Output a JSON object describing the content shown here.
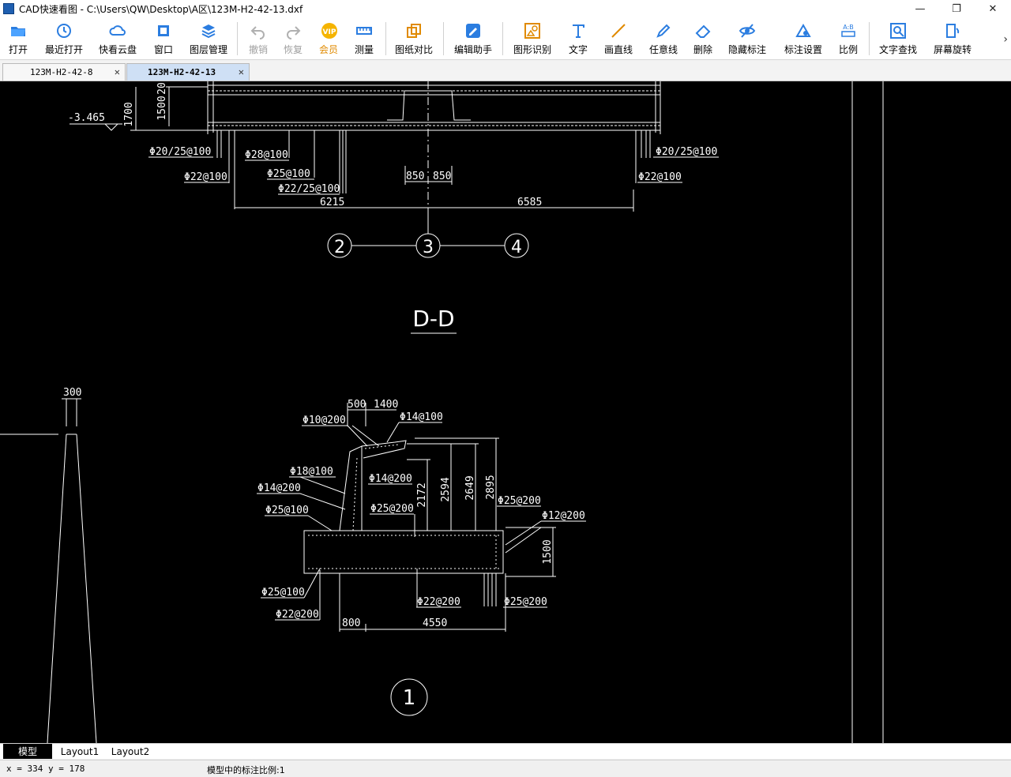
{
  "window": {
    "title": "CAD快速看图 - C:\\Users\\QW\\Desktop\\A区\\123M-H2-42-13.dxf",
    "minimize": "—",
    "restore": "❐",
    "close": "✕"
  },
  "toolbar": {
    "items": [
      {
        "label": "打开",
        "icon": "folder-open-icon",
        "enabled": true
      },
      {
        "label": "最近打开",
        "icon": "history-icon",
        "enabled": true
      },
      {
        "label": "快看云盘",
        "icon": "cloud-icon",
        "enabled": true
      },
      {
        "label": "窗口",
        "icon": "window-icon",
        "enabled": true
      },
      {
        "label": "图层管理",
        "icon": "layers-icon",
        "enabled": true
      },
      {
        "label": "撤销",
        "icon": "undo-icon",
        "enabled": false
      },
      {
        "label": "恢复",
        "icon": "redo-icon",
        "enabled": false
      },
      {
        "label": "会员",
        "icon": "vip-icon",
        "enabled": true
      },
      {
        "label": "测量",
        "icon": "ruler-icon",
        "enabled": true
      },
      {
        "label": "图纸对比",
        "icon": "compare-icon",
        "enabled": true
      },
      {
        "label": "编辑助手",
        "icon": "edit-helper-icon",
        "enabled": true
      },
      {
        "label": "图形识别",
        "icon": "shape-recognize-icon",
        "enabled": true
      },
      {
        "label": "文字",
        "icon": "text-icon",
        "enabled": true
      },
      {
        "label": "画直线",
        "icon": "line-icon",
        "enabled": true
      },
      {
        "label": "任意线",
        "icon": "pen-icon",
        "enabled": true
      },
      {
        "label": "删除",
        "icon": "eraser-icon",
        "enabled": true
      },
      {
        "label": "隐藏标注",
        "icon": "eye-hide-icon",
        "enabled": true
      },
      {
        "label": "标注设置",
        "icon": "dimension-settings-icon",
        "enabled": true
      },
      {
        "label": "比例",
        "icon": "scale-icon",
        "enabled": true
      },
      {
        "label": "文字查找",
        "icon": "text-search-icon",
        "enabled": true
      },
      {
        "label": "屏幕旋转",
        "icon": "rotate-screen-icon",
        "enabled": true
      }
    ],
    "more": "›",
    "vip_badge": "VIP"
  },
  "doc_tabs": [
    {
      "label": "123M-H2-42-8",
      "active": false,
      "close": "✕"
    },
    {
      "label": "123M-H2-42-13",
      "active": true,
      "close": "✕"
    }
  ],
  "drawing": {
    "top_section": {
      "elevation": "-3.465",
      "dim_1700": "1700",
      "dim_1500": "1500",
      "dim_20": "20",
      "rebar_left_1": "Φ20/25@100",
      "rebar_left_2": "Φ22@100",
      "rebar_mid_1": "Φ28@100",
      "rebar_mid_2": "Φ25@100",
      "rebar_mid_3": "Φ22/25@100",
      "rebar_right_1": "Φ20/25@100",
      "rebar_right_2": "Φ22@100",
      "dim_850_a": "850",
      "dim_850_b": "850",
      "dim_6215": "6215",
      "dim_6585": "6585",
      "axis_2": "2",
      "axis_3": "3",
      "axis_4": "4"
    },
    "section_title": "D-D",
    "bottom_section": {
      "dim_300": "300",
      "dim_500": "500",
      "dim_1400": "1400",
      "rebar_phi10_200": "Φ10@200",
      "rebar_phi14_100": "Φ14@100",
      "rebar_phi18_100": "Φ18@100",
      "rebar_phi14_200_a": "Φ14@200",
      "rebar_phi14_200_b": "Φ14@200",
      "rebar_phi25_100_a": "Φ25@100",
      "rebar_phi25_200_a": "Φ25@200",
      "rebar_phi25_200_b": "Φ25@200",
      "rebar_phi12_200": "Φ12@200",
      "rebar_phi25_100_b": "Φ25@100",
      "rebar_phi22_200_a": "Φ22@200",
      "rebar_phi22_200_b": "Φ22@200",
      "rebar_phi25_200_c": "Φ25@200",
      "dim_2172": "2172",
      "dim_2594": "2594",
      "dim_2649": "2649",
      "dim_2895": "2895",
      "dim_1500": "1500",
      "dim_800": "800",
      "dim_4550": "4550",
      "axis_1": "1"
    }
  },
  "layout_tabs": [
    {
      "label": "模型",
      "active": true
    },
    {
      "label": "Layout1",
      "active": false
    },
    {
      "label": "Layout2",
      "active": false
    }
  ],
  "status": {
    "coords": "x = 334  y = 178",
    "scale_text": "模型中的标注比例:1"
  }
}
